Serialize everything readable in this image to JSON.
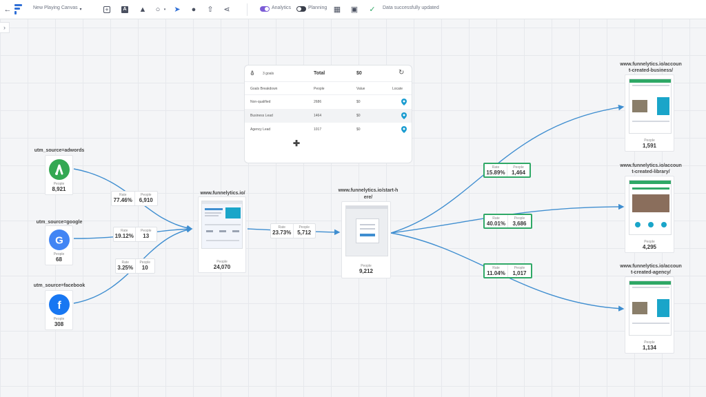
{
  "toolbar": {
    "canvas_name": "New Playing Canvas",
    "analytics_label": "Analytics",
    "planning_label": "Planning",
    "status_message": "Data successfully updated",
    "colors": {
      "analytics_toggle": "#7c5cd6",
      "planning_toggle": "#3a3f4b",
      "brand": "#2f6fd6"
    }
  },
  "goals": {
    "count_label": "3 goals",
    "total_label": "Total",
    "total_value": "$0",
    "columns": [
      "Goals Breakdown",
      "People",
      "Value",
      "Locate"
    ],
    "rows": [
      {
        "name": "Non-qualified",
        "people": "2686",
        "value": "$0"
      },
      {
        "name": "Business Lead",
        "people": "1464",
        "value": "$0"
      },
      {
        "name": "Agency Lead",
        "people": "1017",
        "value": "$0"
      }
    ],
    "add_icon": "plus-icon"
  },
  "sources": [
    {
      "label": "utm_source=adwords",
      "icon": "google-ads-icon",
      "people_caption": "People",
      "people": "8,921",
      "color": "#34a853"
    },
    {
      "label": "utm_source=google",
      "icon": "google-icon",
      "people_caption": "People",
      "people": "68",
      "color": "#4285f4"
    },
    {
      "label": "utm_source=facebook",
      "icon": "facebook-icon",
      "people_caption": "People",
      "people": "308",
      "color": "#1877f2"
    }
  ],
  "source_badges": [
    {
      "rate_caption": "Rate",
      "rate": "77.46%",
      "people_caption": "People",
      "people": "6,910"
    },
    {
      "rate_caption": "Rate",
      "rate": "19.12%",
      "people_caption": "People",
      "people": "13"
    },
    {
      "rate_caption": "Rate",
      "rate": "3.25%",
      "people_caption": "People",
      "people": "10"
    }
  ],
  "home": {
    "label": "www.funnelytics.io/",
    "people_caption": "People",
    "people": "24,070"
  },
  "mid_badge": {
    "rate_caption": "Rate",
    "rate": "23.73%",
    "people_caption": "People",
    "people": "5,712"
  },
  "start": {
    "label_line1": "www.funnelytics.io/start-h",
    "label_line2": "ere/",
    "people_caption": "People",
    "people": "9,212"
  },
  "out_badges": [
    {
      "rate_caption": "Rate",
      "rate": "15.89%",
      "people_caption": "People",
      "people": "1,464"
    },
    {
      "rate_caption": "Rate",
      "rate": "40.01%",
      "people_caption": "People",
      "people": "3,686"
    },
    {
      "rate_caption": "Rate",
      "rate": "11.04%",
      "people_caption": "People",
      "people": "1,017"
    }
  ],
  "destinations": [
    {
      "label_line1": "www.funnelytics.io/accoun",
      "label_line2": "t-created-business/",
      "people_caption": "People",
      "people": "1,591"
    },
    {
      "label_line1": "www.funnelytics.io/accoun",
      "label_line2": "t-created-library/",
      "people_caption": "People",
      "people": "4,295"
    },
    {
      "label_line1": "www.funnelytics.io/accoun",
      "label_line2": "t-created-agency/",
      "people_caption": "People",
      "people": "1,134"
    }
  ],
  "colors": {
    "link": "#3f8ed0",
    "badge_highlight": "#2fa866",
    "pin": "#1a9cd0"
  }
}
